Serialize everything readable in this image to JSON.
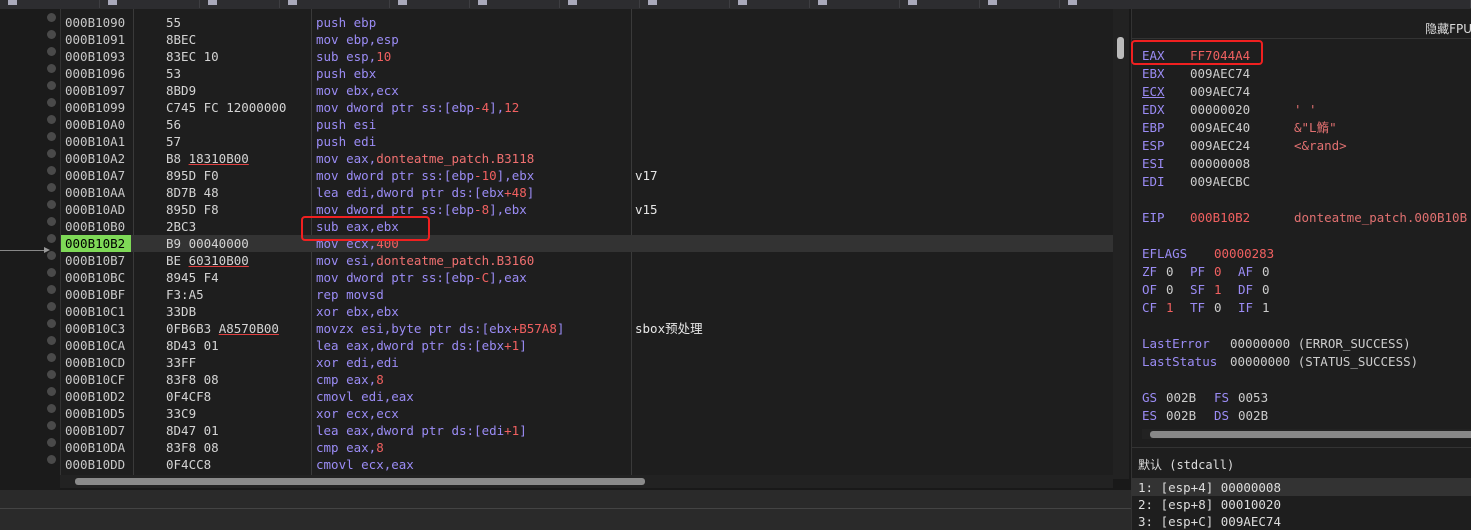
{
  "toolbar": {
    "items": [
      "",
      "",
      "",
      "",
      "",
      "",
      "",
      "",
      "",
      "",
      "",
      "",
      ""
    ]
  },
  "disasm": {
    "rows": [
      {
        "addr": "000B1090",
        "hex": "55",
        "asm": [
          [
            "k",
            "push "
          ],
          [
            "r",
            "ebp"
          ]
        ],
        "cm": ""
      },
      {
        "addr": "000B1091",
        "hex": "8BEC",
        "asm": [
          [
            "k",
            "mov "
          ],
          [
            "r",
            "ebp,esp"
          ]
        ],
        "cm": ""
      },
      {
        "addr": "000B1093",
        "hex": "83EC 10",
        "asm": [
          [
            "k",
            "sub "
          ],
          [
            "r",
            "esp,"
          ],
          [
            "n",
            "10"
          ]
        ],
        "cm": ""
      },
      {
        "addr": "000B1096",
        "hex": "53",
        "asm": [
          [
            "k",
            "push "
          ],
          [
            "r",
            "ebx"
          ]
        ],
        "cm": ""
      },
      {
        "addr": "000B1097",
        "hex": "8BD9",
        "asm": [
          [
            "k",
            "mov "
          ],
          [
            "r",
            "ebx,ecx"
          ]
        ],
        "cm": ""
      },
      {
        "addr": "000B1099",
        "hex": "C745 FC 12000000",
        "asm": [
          [
            "k",
            "mov dword ptr ss:["
          ],
          [
            "r",
            "ebp"
          ],
          [
            "n",
            "-4"
          ],
          [
            "k",
            "],"
          ],
          [
            "n",
            "12"
          ]
        ],
        "cm": ""
      },
      {
        "addr": "000B10A0",
        "hex": "56",
        "asm": [
          [
            "k",
            "push "
          ],
          [
            "r",
            "esi"
          ]
        ],
        "cm": ""
      },
      {
        "addr": "000B10A1",
        "hex": "57",
        "asm": [
          [
            "k",
            "push "
          ],
          [
            "r",
            "edi"
          ]
        ],
        "cm": ""
      },
      {
        "addr": "000B10A2",
        "hex": "B8 ",
        "hexu": "18310B00",
        "asm": [
          [
            "k",
            "mov "
          ],
          [
            "r",
            "eax,"
          ],
          [
            "lb",
            "donteatme_patch.B3118"
          ]
        ],
        "cm": ""
      },
      {
        "addr": "000B10A7",
        "hex": "895D F0",
        "asm": [
          [
            "k",
            "mov dword ptr ss:["
          ],
          [
            "r",
            "ebp"
          ],
          [
            "n",
            "-10"
          ],
          [
            "k",
            "],"
          ],
          [
            "r",
            "ebx"
          ]
        ],
        "cm": "v17"
      },
      {
        "addr": "000B10AA",
        "hex": "8D7B 48",
        "asm": [
          [
            "k",
            "lea "
          ],
          [
            "r",
            "edi,"
          ],
          [
            "k",
            "dword ptr ds:["
          ],
          [
            "r",
            "ebx"
          ],
          [
            "n",
            "+48"
          ],
          [
            "k",
            "]"
          ]
        ],
        "cm": ""
      },
      {
        "addr": "000B10AD",
        "hex": "895D F8",
        "asm": [
          [
            "k",
            "mov dword ptr ss:["
          ],
          [
            "r",
            "ebp"
          ],
          [
            "n",
            "-8"
          ],
          [
            "k",
            "],"
          ],
          [
            "r",
            "ebx"
          ]
        ],
        "cm": "v15"
      },
      {
        "addr": "000B10B0",
        "hex": "2BC3",
        "asm": [
          [
            "k",
            "sub "
          ],
          [
            "r",
            "eax,ebx"
          ]
        ],
        "cm": ""
      },
      {
        "addr": "000B10B2",
        "hex": "B9 00040000",
        "asm": [
          [
            "k",
            "mov "
          ],
          [
            "r",
            "ecx,"
          ],
          [
            "n",
            "400"
          ]
        ],
        "cm": "",
        "cur": true
      },
      {
        "addr": "000B10B7",
        "hex": "BE ",
        "hexu": "60310B00",
        "asm": [
          [
            "k",
            "mov "
          ],
          [
            "r",
            "esi,"
          ],
          [
            "lb",
            "donteatme_patch.B3160"
          ]
        ],
        "cm": ""
      },
      {
        "addr": "000B10BC",
        "hex": "8945 F4",
        "asm": [
          [
            "k",
            "mov dword ptr ss:["
          ],
          [
            "r",
            "ebp"
          ],
          [
            "n",
            "-C"
          ],
          [
            "k",
            "],"
          ],
          [
            "r",
            "eax"
          ]
        ],
        "cm": ""
      },
      {
        "addr": "000B10BF",
        "hex": "F3:A5",
        "asm": [
          [
            "k",
            "rep movsd"
          ]
        ],
        "cm": ""
      },
      {
        "addr": "000B10C1",
        "hex": "33DB",
        "asm": [
          [
            "k",
            "xor "
          ],
          [
            "r",
            "ebx,ebx"
          ]
        ],
        "cm": ""
      },
      {
        "addr": "000B10C3",
        "hex": "0FB6B3 ",
        "hexu": "A8570B00",
        "asm": [
          [
            "k",
            "movzx "
          ],
          [
            "r",
            "esi,"
          ],
          [
            "k",
            "byte ptr ds:["
          ],
          [
            "r",
            "ebx"
          ],
          [
            "n",
            "+B57A8"
          ],
          [
            "k",
            "]"
          ]
        ],
        "cm": "sbox预处理"
      },
      {
        "addr": "000B10CA",
        "hex": "8D43 01",
        "asm": [
          [
            "k",
            "lea "
          ],
          [
            "r",
            "eax,"
          ],
          [
            "k",
            "dword ptr ds:["
          ],
          [
            "r",
            "ebx"
          ],
          [
            "n",
            "+1"
          ],
          [
            "k",
            "]"
          ]
        ],
        "cm": ""
      },
      {
        "addr": "000B10CD",
        "hex": "33FF",
        "asm": [
          [
            "k",
            "xor "
          ],
          [
            "r",
            "edi,edi"
          ]
        ],
        "cm": ""
      },
      {
        "addr": "000B10CF",
        "hex": "83F8 08",
        "asm": [
          [
            "k",
            "cmp "
          ],
          [
            "r",
            "eax,"
          ],
          [
            "n",
            "8"
          ]
        ],
        "cm": ""
      },
      {
        "addr": "000B10D2",
        "hex": "0F4CF8",
        "asm": [
          [
            "k",
            "cmovl "
          ],
          [
            "r",
            "edi,eax"
          ]
        ],
        "cm": ""
      },
      {
        "addr": "000B10D5",
        "hex": "33C9",
        "asm": [
          [
            "k",
            "xor "
          ],
          [
            "r",
            "ecx,ecx"
          ]
        ],
        "cm": ""
      },
      {
        "addr": "000B10D7",
        "hex": "8D47 01",
        "asm": [
          [
            "k",
            "lea "
          ],
          [
            "r",
            "eax,"
          ],
          [
            "k",
            "dword ptr ds:["
          ],
          [
            "r",
            "edi"
          ],
          [
            "n",
            "+1"
          ],
          [
            "k",
            "]"
          ]
        ],
        "cm": ""
      },
      {
        "addr": "000B10DA",
        "hex": "83F8 08",
        "asm": [
          [
            "k",
            "cmp "
          ],
          [
            "r",
            "eax,"
          ],
          [
            "n",
            "8"
          ]
        ],
        "cm": ""
      },
      {
        "addr": "000B10DD",
        "hex": "0F4CC8",
        "asm": [
          [
            "k",
            "cmovl "
          ],
          [
            "r",
            "ecx,eax"
          ]
        ],
        "cm": ""
      }
    ]
  },
  "regs": {
    "header": "隐藏FPU",
    "gp": [
      {
        "n": "EAX",
        "v": "FF7044A4",
        "ch": true
      },
      {
        "n": "EBX",
        "v": "009AEC74",
        "c": ""
      },
      {
        "n": "ECX",
        "v": "009AEC74",
        "c": "",
        "u": true
      },
      {
        "n": "EDX",
        "v": "00000020",
        "c": "' '"
      },
      {
        "n": "EBP",
        "v": "009AEC40",
        "c": "&\"L鰖\""
      },
      {
        "n": "ESP",
        "v": "009AEC24",
        "c": "<&rand>"
      },
      {
        "n": "ESI",
        "v": "00000008",
        "c": ""
      },
      {
        "n": "EDI",
        "v": "009AECBC",
        "c": ""
      }
    ],
    "eip": {
      "n": "EIP",
      "v": "000B10B2",
      "c": "donteatme_patch.000B10B"
    },
    "eflags": {
      "n": "EFLAGS",
      "v": "00000283"
    },
    "flags": [
      [
        [
          "ZF",
          "0"
        ],
        [
          "PF",
          "0",
          true
        ],
        [
          "AF",
          "0"
        ]
      ],
      [
        [
          "OF",
          "0"
        ],
        [
          "SF",
          "1",
          true
        ],
        [
          "DF",
          "0"
        ]
      ],
      [
        [
          "CF",
          "1",
          true
        ],
        [
          "TF",
          "0"
        ],
        [
          "IF",
          "1"
        ]
      ]
    ],
    "lasterr": {
      "n": "LastError",
      "v": "00000000 (ERROR_SUCCESS)"
    },
    "laststat": {
      "n": "LastStatus",
      "v": "00000000 (STATUS_SUCCESS)"
    },
    "seg": [
      [
        [
          "GS",
          "002B"
        ],
        [
          "FS",
          "0053"
        ]
      ],
      [
        [
          "ES",
          "002B"
        ],
        [
          "DS",
          "002B"
        ]
      ]
    ]
  },
  "callconv": "默认 (stdcall)",
  "stack": [
    "1: [esp+4] 00000008",
    "2: [esp+8] 00010020",
    "3: [esp+C] 009AEC74"
  ]
}
